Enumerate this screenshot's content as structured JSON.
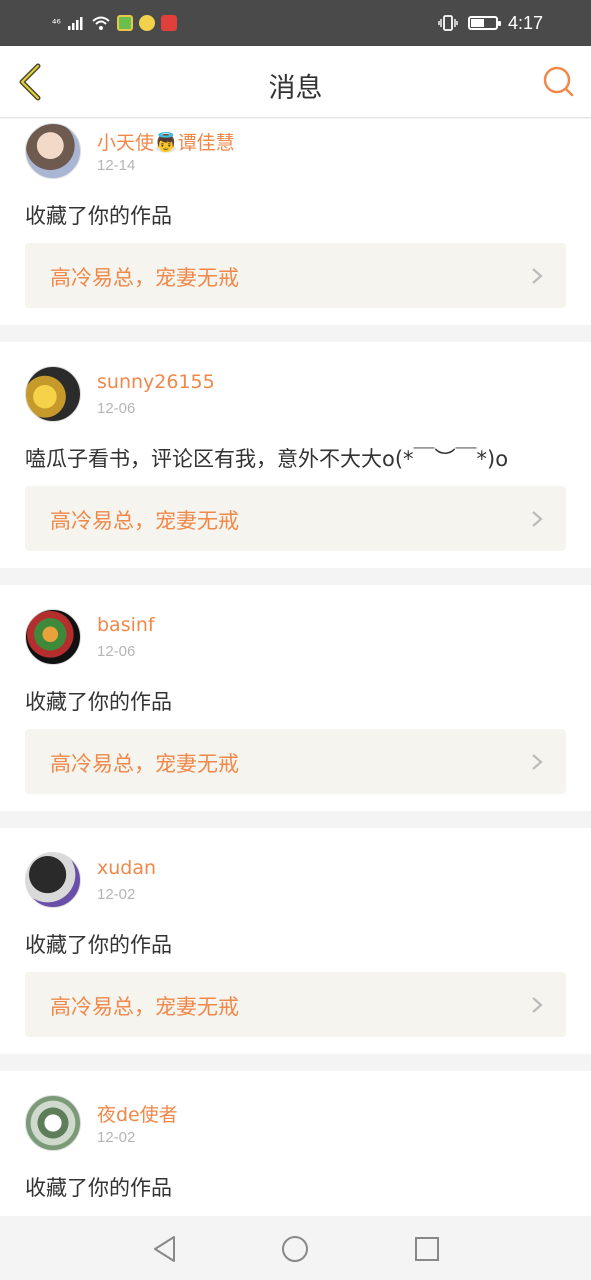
{
  "status_bar": {
    "signal_label": "⁴⁶",
    "time": "4:17",
    "battery_level": 0.55,
    "icons": [
      "signal-icon",
      "wifi-icon",
      "app-green-icon",
      "app-emoji-icon",
      "app-red-icon",
      "vibrate-icon",
      "battery-icon"
    ]
  },
  "nav": {
    "title": "消息",
    "back_icon": "chevron-left-icon",
    "search_icon": "search-icon",
    "accent": "#f0884a"
  },
  "messages": [
    {
      "user": "小天使👼谭佳慧",
      "date": "12-14",
      "content": "收藏了你的作品",
      "work": "高冷易总，宠妻无戒"
    },
    {
      "user": "sunny26155",
      "date": "12-06",
      "content": "嗑瓜子看书，评论区有我，意外不大大o(*￣︶￣*)o",
      "work": "高冷易总，宠妻无戒"
    },
    {
      "user": "basinf",
      "date": "12-06",
      "content": "收藏了你的作品",
      "work": "高冷易总，宠妻无戒"
    },
    {
      "user": "xudan",
      "date": "12-02",
      "content": "收藏了你的作品",
      "work": "高冷易总，宠妻无戒"
    },
    {
      "user": "夜de使者",
      "date": "12-02",
      "content": "收藏了你的作品",
      "work": ""
    }
  ],
  "bottom_nav": {
    "icons": [
      "back-triangle-icon",
      "home-circle-icon",
      "recent-square-icon"
    ]
  }
}
